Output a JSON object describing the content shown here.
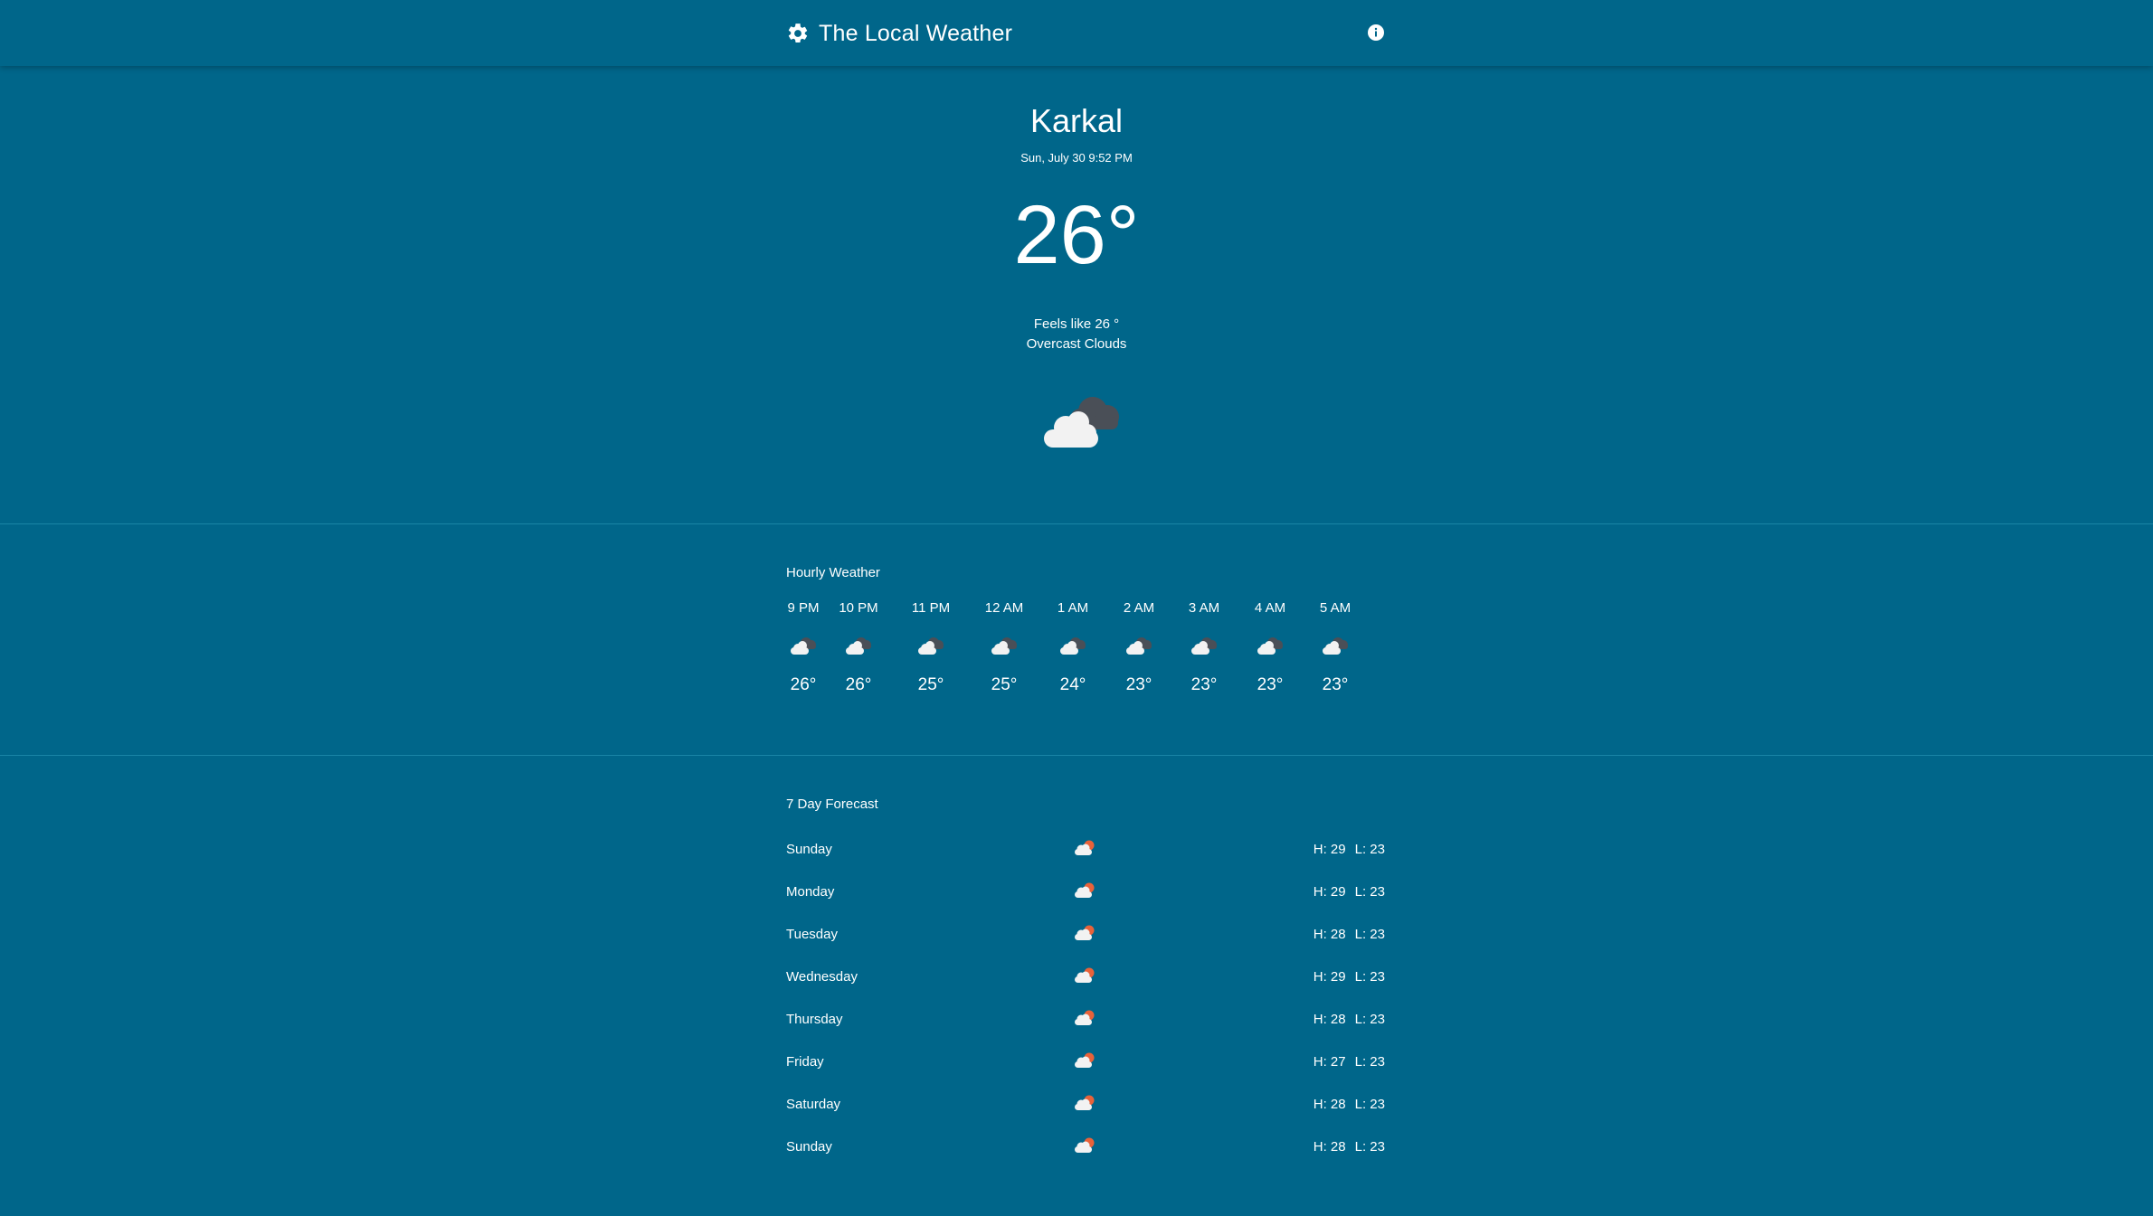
{
  "app": {
    "title": "The Local Weather",
    "settings_icon": "gear-icon",
    "info_icon": "info-icon"
  },
  "current": {
    "city": "Karkal",
    "datetime": "Sun, July 30 9:52 PM",
    "temperature": "26°",
    "feels_like": "Feels like 26 °",
    "description": "Overcast Clouds",
    "icon": "overcast-clouds-night-icon"
  },
  "hourly": {
    "title": "Hourly Weather",
    "items": [
      {
        "time": "9 PM",
        "temp": "26°",
        "icon": "cloud-night-icon"
      },
      {
        "time": "10 PM",
        "temp": "26°",
        "icon": "cloud-night-icon"
      },
      {
        "time": "11 PM",
        "temp": "25°",
        "icon": "cloud-night-icon"
      },
      {
        "time": "12 AM",
        "temp": "25°",
        "icon": "cloud-night-icon"
      },
      {
        "time": "1 AM",
        "temp": "24°",
        "icon": "cloud-night-icon"
      },
      {
        "time": "2 AM",
        "temp": "23°",
        "icon": "cloud-night-icon"
      },
      {
        "time": "3 AM",
        "temp": "23°",
        "icon": "cloud-night-icon"
      },
      {
        "time": "4 AM",
        "temp": "23°",
        "icon": "cloud-night-icon"
      },
      {
        "time": "5 AM",
        "temp": "23°",
        "icon": "cloud-night-icon"
      }
    ]
  },
  "forecast": {
    "title": "7 Day Forecast",
    "days": [
      {
        "day": "Sunday",
        "high": "H: 29",
        "low": "L: 23",
        "icon": "cloud-sun-icon"
      },
      {
        "day": "Monday",
        "high": "H: 29",
        "low": "L: 23",
        "icon": "cloud-sun-icon"
      },
      {
        "day": "Tuesday",
        "high": "H: 28",
        "low": "L: 23",
        "icon": "cloud-sun-icon"
      },
      {
        "day": "Wednesday",
        "high": "H: 29",
        "low": "L: 23",
        "icon": "cloud-sun-icon"
      },
      {
        "day": "Thursday",
        "high": "H: 28",
        "low": "L: 23",
        "icon": "cloud-sun-icon"
      },
      {
        "day": "Friday",
        "high": "H: 27",
        "low": "L: 23",
        "icon": "cloud-sun-icon"
      },
      {
        "day": "Saturday",
        "high": "H: 28",
        "low": "L: 23",
        "icon": "cloud-sun-icon"
      },
      {
        "day": "Sunday",
        "high": "H: 28",
        "low": "L: 23",
        "icon": "cloud-sun-icon"
      }
    ]
  },
  "colors": {
    "background": "#00668a",
    "divider": "#1a85a6",
    "text": "#ffffff",
    "cloud_dark": "#4a4f57",
    "cloud_light": "#f2f2f2",
    "sun": "#e8623a"
  }
}
